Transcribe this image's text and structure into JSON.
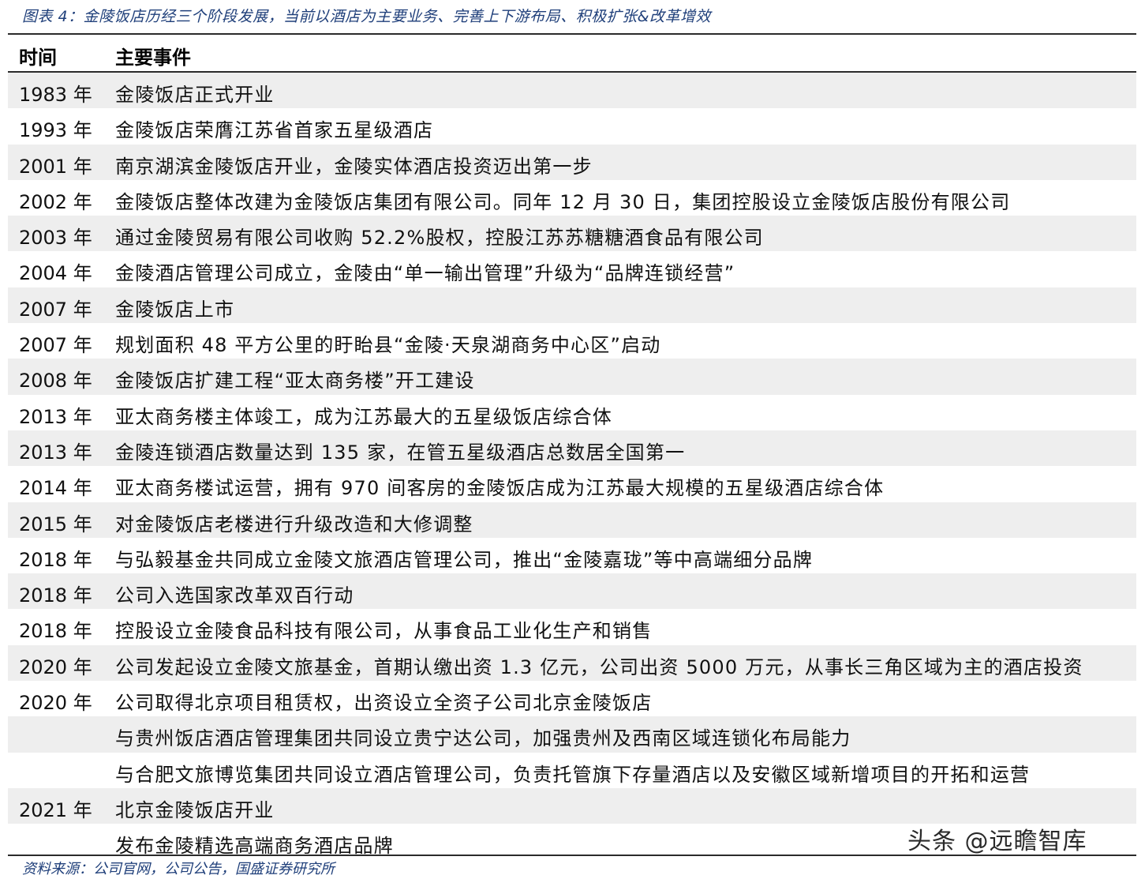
{
  "caption": "图表 4：金陵饭店历经三个阶段发展，当前以酒店为主要业务、完善上下游布局、积极扩张&改革增效",
  "header": {
    "time": "时间",
    "event": "主要事件"
  },
  "rows": [
    {
      "year": "1983 年",
      "event": "金陵饭店正式开业"
    },
    {
      "year": "1993 年",
      "event": "金陵饭店荣膺江苏省首家五星级酒店"
    },
    {
      "year": "2001 年",
      "event": "南京湖滨金陵饭店开业，金陵实体酒店投资迈出第一步"
    },
    {
      "year": "2002 年",
      "event": "金陵饭店整体改建为金陵饭店集团有限公司。同年 12 月 30 日，集团控股设立金陵饭店股份有限公司"
    },
    {
      "year": "2003 年",
      "event": "通过金陵贸易有限公司收购 52.2%股权，控股江苏苏糖糖酒食品有限公司"
    },
    {
      "year": "2004 年",
      "event": "金陵酒店管理公司成立，金陵由“单一输出管理”升级为“品牌连锁经营”"
    },
    {
      "year": "2007 年",
      "event": "金陵饭店上市"
    },
    {
      "year": "2007 年",
      "event": "规划面积 48 平方公里的盱眙县“金陵·天泉湖商务中心区”启动"
    },
    {
      "year": "2008 年",
      "event": "金陵饭店扩建工程“亚太商务楼”开工建设"
    },
    {
      "year": "2013 年",
      "event": "亚太商务楼主体竣工，成为江苏最大的五星级饭店综合体"
    },
    {
      "year": "2013 年",
      "event": "金陵连锁酒店数量达到 135 家，在管五星级酒店总数居全国第一"
    },
    {
      "year": "2014 年",
      "event": "亚太商务楼试运营，拥有 970 间客房的金陵饭店成为江苏最大规模的五星级酒店综合体"
    },
    {
      "year": "2015 年",
      "event": "对金陵饭店老楼进行升级改造和大修调整"
    },
    {
      "year": "2018 年",
      "event": "与弘毅基金共同成立金陵文旅酒店管理公司，推出“金陵嘉珑”等中高端细分品牌"
    },
    {
      "year": "2018 年",
      "event": "公司入选国家改革双百行动"
    },
    {
      "year": "2018 年",
      "event": "控股设立金陵食品科技有限公司，从事食品工业化生产和销售"
    },
    {
      "year": "2020 年",
      "event": "公司发起设立金陵文旅基金，首期认缴出资 1.3 亿元，公司出资 5000 万元，从事长三角区域为主的酒店投资"
    },
    {
      "year": "2020 年",
      "event": "公司取得北京项目租赁权，出资设立全资子公司北京金陵饭店"
    },
    {
      "year": "",
      "event": "与贵州饭店酒店管理集团共同设立贵宁达公司，加强贵州及西南区域连锁化布局能力"
    },
    {
      "year": "",
      "event": "与合肥文旅博览集团共同设立酒店管理公司，负责托管旗下存量酒店以及安徽区域新增项目的开拓和运营"
    },
    {
      "year": "2021 年",
      "event": "北京金陵饭店开业"
    },
    {
      "year": "",
      "event": "发布金陵精选高端商务酒店品牌"
    }
  ],
  "source": "资料来源：公司官网，公司公告，国盛证券研究所",
  "watermark": "头条 @远瞻智库"
}
